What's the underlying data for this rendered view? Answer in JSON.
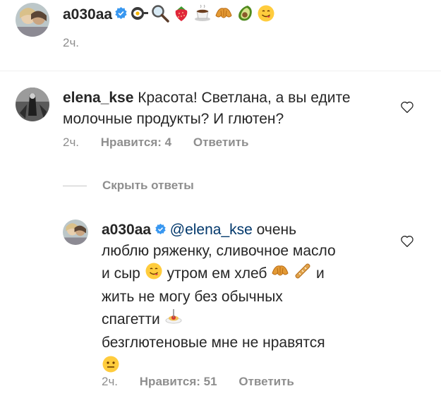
{
  "top_post": {
    "username": "a030aa",
    "emojis": [
      "frying-pan-egg",
      "magnifier",
      "strawberry",
      "coffee",
      "croissant",
      "avocado",
      "yum-face"
    ],
    "time": "2ч."
  },
  "comment": {
    "username": "elena_kse",
    "text": "Красота! Светлана, а вы едите молочные продукты? И глютен?",
    "time": "2ч.",
    "likes": "Нравится: 4",
    "reply": "Ответить"
  },
  "hide_replies": "Скрыть ответы",
  "reply": {
    "username": "a030aa",
    "mention": "@elena_kse",
    "line1": "очень",
    "line2": "люблю ряженку, сливочное масло",
    "line3a": "и сыр",
    "line3b": "утром ем хлеб",
    "line3c": "и",
    "line4": "жить не могу без обычных",
    "line5": "спагетти",
    "line6": "безглютеновые мне не нравятся",
    "time": "2ч.",
    "likes": "Нравится: 51",
    "reply_label": "Ответить"
  },
  "colors": {
    "verified": "#3897f0",
    "mention": "#00376b",
    "meta": "#8e8e8e"
  }
}
